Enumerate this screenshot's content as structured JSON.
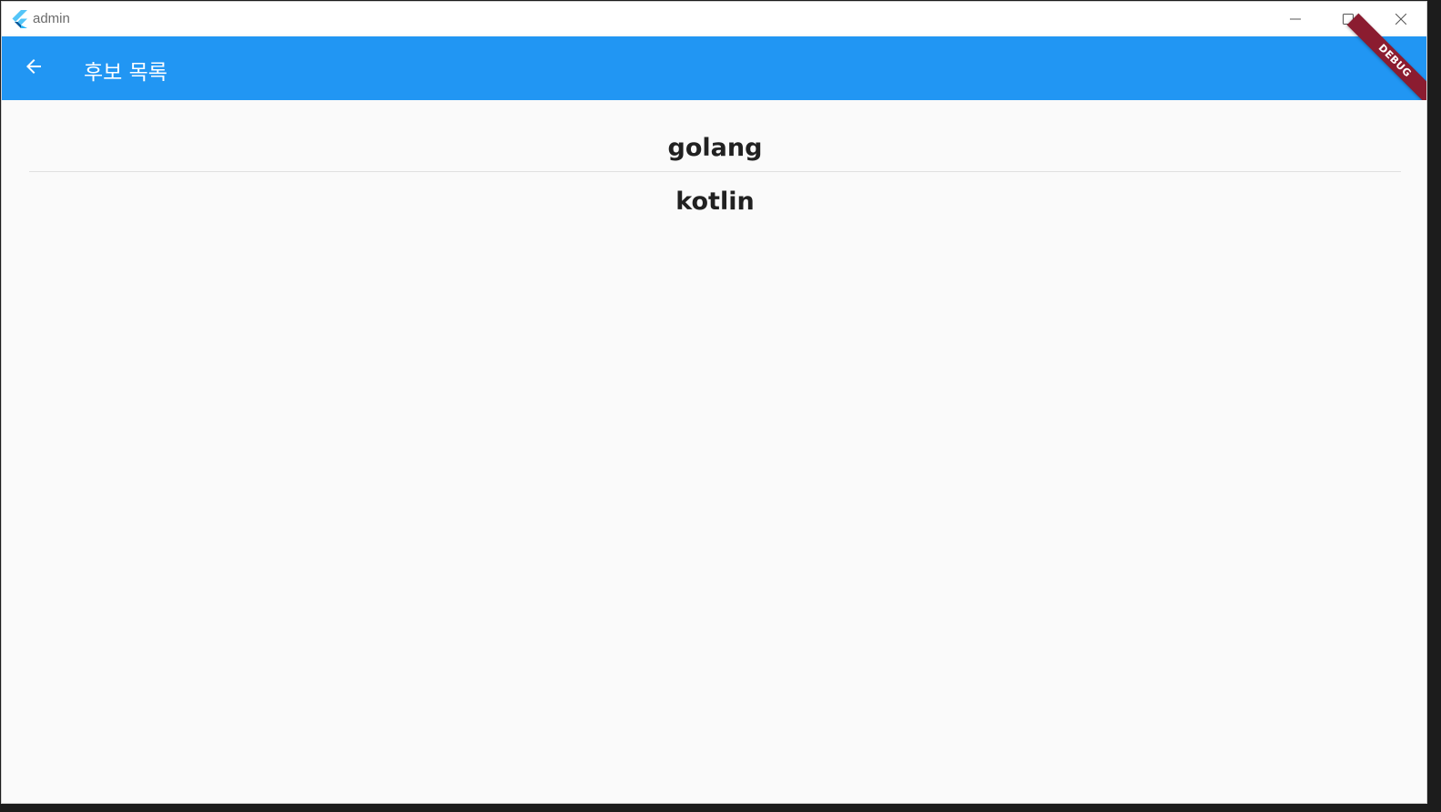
{
  "window": {
    "title": "admin",
    "icon": "flutter-logo-icon",
    "controls": [
      "minimize-icon",
      "maximize-icon",
      "close-icon"
    ]
  },
  "appbar": {
    "title": "후보 목록",
    "back_icon": "arrow-back-icon",
    "color": "#2196f3",
    "debug_banner": "DEBUG"
  },
  "list": {
    "items": [
      {
        "label": "golang"
      },
      {
        "label": "kotlin"
      }
    ]
  }
}
